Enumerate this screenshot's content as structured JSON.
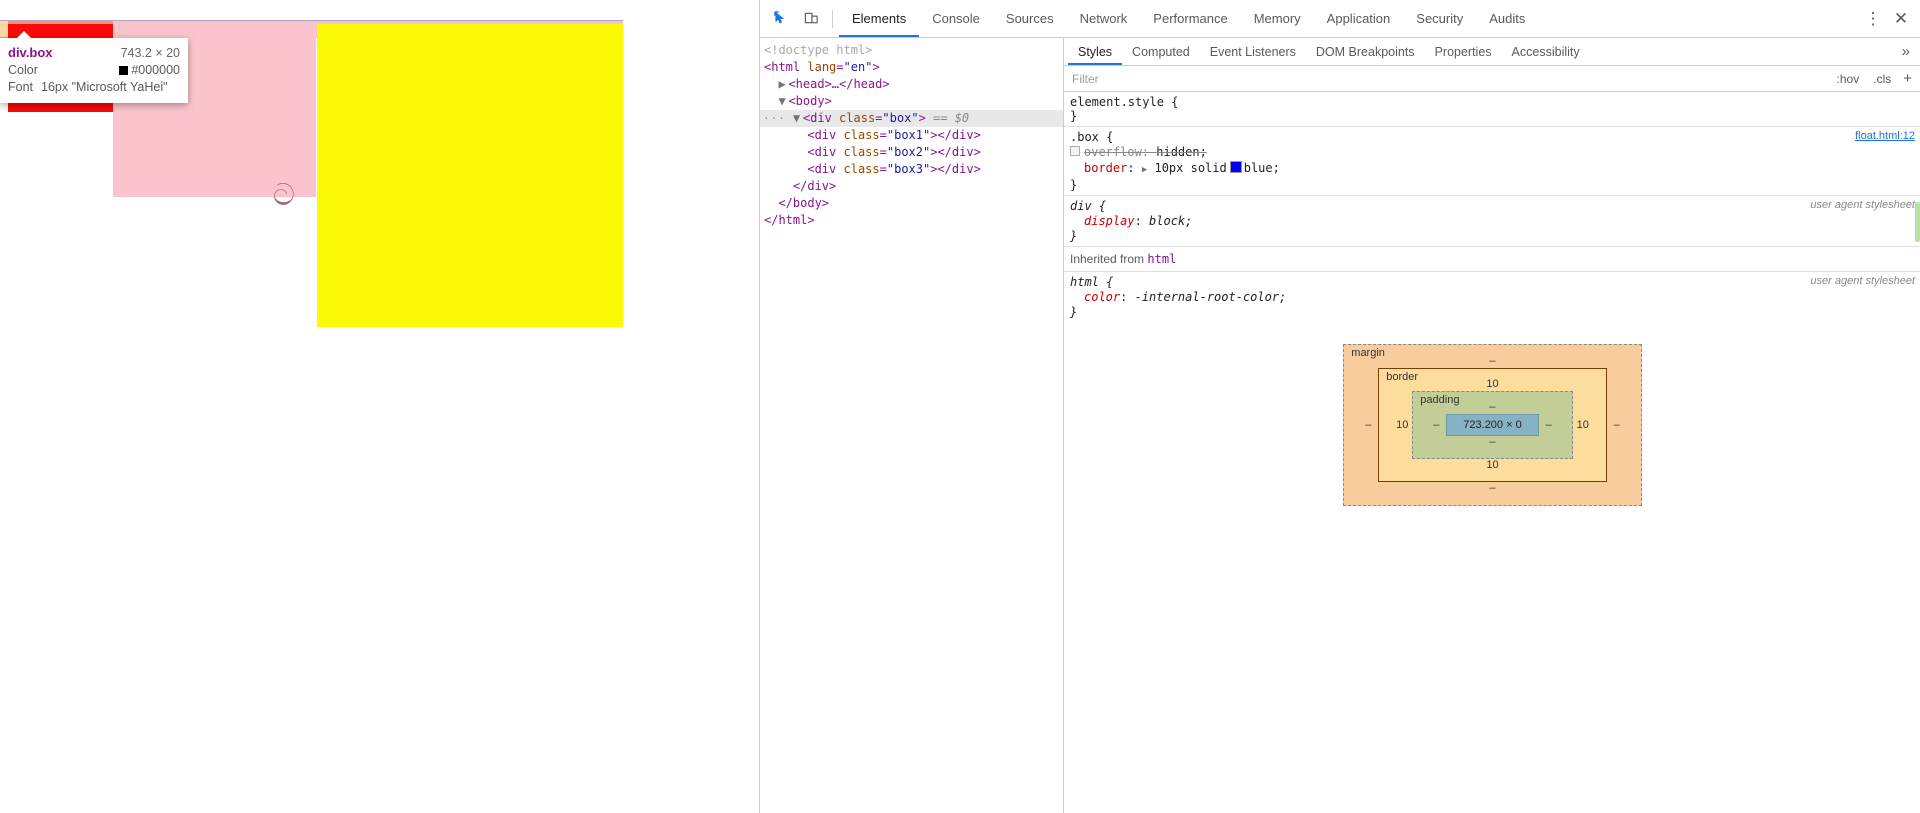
{
  "inspector_tooltip": {
    "selector": "div.box",
    "dimensions": "743.2 × 20",
    "color_label": "Color",
    "color_value": "#000000",
    "color_swatch": "#000000",
    "font_label": "Font",
    "font_value": "16px \"Microsoft YaHei\""
  },
  "page": {
    "scribble_glyph": "ට",
    "boxes": [
      {
        "name": "box1",
        "color": "#fa0b0b"
      },
      {
        "name": "box2",
        "color": "#fbc4cc"
      },
      {
        "name": "box3",
        "color": "#fcf906"
      }
    ],
    "highlight_colors": {
      "margin": "#b0a4c8",
      "padding": "#fdd9a0",
      "content": "#fb926b",
      "pink": "#f9c3c9"
    }
  },
  "devtools": {
    "toolbar": {
      "inspect_icon": "inspect-cursor-icon",
      "device_icon": "device-toolbar-icon",
      "menu_icon": "⋮",
      "close_icon": "✕",
      "tabs": [
        {
          "label": "Elements",
          "selected": true
        },
        {
          "label": "Console",
          "selected": false
        },
        {
          "label": "Sources",
          "selected": false
        },
        {
          "label": "Network",
          "selected": false
        },
        {
          "label": "Performance",
          "selected": false
        },
        {
          "label": "Memory",
          "selected": false
        },
        {
          "label": "Application",
          "selected": false
        },
        {
          "label": "Security",
          "selected": false
        },
        {
          "label": "Audits",
          "selected": false
        }
      ]
    },
    "dom": {
      "lines": [
        {
          "type": "doctype",
          "text": "<!doctype html>"
        },
        {
          "type": "open_html"
        },
        {
          "type": "head"
        },
        {
          "type": "body"
        },
        {
          "type": "selected_div"
        },
        {
          "type": "child",
          "class": "box1"
        },
        {
          "type": "child",
          "class": "box2"
        },
        {
          "type": "child",
          "class": "box3"
        },
        {
          "type": "close_div"
        },
        {
          "type": "close_body"
        },
        {
          "type": "close_html"
        }
      ],
      "doctype": "<!doctype html>",
      "html_tag": "html",
      "html_attr": "lang",
      "html_val": "en",
      "head_text": "<head>…</head>",
      "body_text": "<body>",
      "selected_class": "box",
      "selected_suffix": "== $0",
      "close_div": "</div>",
      "close_body": "</body>",
      "close_html": "</html>",
      "ellipsis": "···"
    },
    "styles": {
      "sub_tabs": [
        {
          "label": "Styles",
          "selected": true
        },
        {
          "label": "Computed",
          "selected": false
        },
        {
          "label": "Event Listeners",
          "selected": false
        },
        {
          "label": "DOM Breakpoints",
          "selected": false
        },
        {
          "label": "Properties",
          "selected": false
        },
        {
          "label": "Accessibility",
          "selected": false
        }
      ],
      "filter_placeholder": "Filter",
      "filter_value": "",
      "hov_label": ":hov",
      "cls_label": ".cls",
      "plus_label": "+",
      "rules": [
        {
          "selector": "element.style {",
          "close": "}",
          "source": "",
          "ua": false,
          "decls": []
        },
        {
          "selector": ".box {",
          "close": "}",
          "source": "float.html:12",
          "ua": false,
          "decls": [
            {
              "prop": "overflow",
              "value": "hidden;",
              "disabled": true,
              "checkbox": true
            },
            {
              "prop": "border",
              "value": "10px solid",
              "color_value": "blue;",
              "swatch": "#0000ee",
              "expandable": true,
              "disabled": false
            }
          ]
        },
        {
          "selector": "div {",
          "close": "}",
          "source": "user agent stylesheet",
          "ua": true,
          "decls": [
            {
              "prop": "display",
              "value": "block;",
              "disabled": false
            }
          ]
        }
      ],
      "inherited_header": "Inherited from",
      "inherited_tag": "html",
      "inherited_rule": {
        "selector": "html {",
        "close": "}",
        "source": "user agent stylesheet",
        "ua": true,
        "decls": [
          {
            "prop": "color",
            "value": "-internal-root-color;",
            "disabled": false
          }
        ]
      }
    },
    "box_model": {
      "margin_label": "margin",
      "margin_top": "–",
      "margin_right": "–",
      "margin_bottom": "–",
      "margin_left": "–",
      "border_label": "border",
      "border_top": "10",
      "border_right": "10",
      "border_bottom": "10",
      "border_left": "10",
      "padding_label": "padding",
      "padding_top": "–",
      "padding_right": "–",
      "padding_bottom": "–",
      "padding_left": "–",
      "content_size": "723.200 × 0"
    }
  }
}
